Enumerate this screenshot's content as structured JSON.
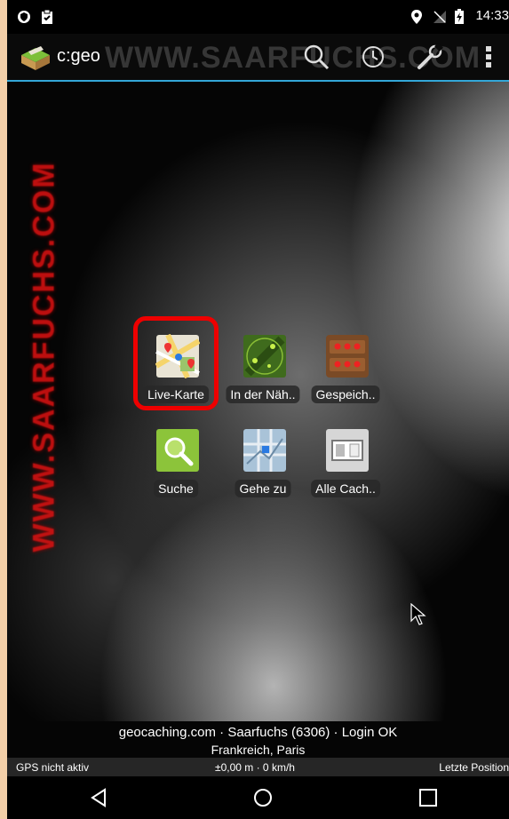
{
  "status_bar": {
    "time": "14:33",
    "icons": [
      "shield-icon",
      "clipboard-icon",
      "location-icon",
      "no-signal-icon",
      "battery-charging-icon"
    ]
  },
  "action_bar": {
    "app_title": "c:geo",
    "watermark": "WWW.SAARFUCHS.COM",
    "actions": [
      "search-icon",
      "history-icon",
      "settings-wrench-icon",
      "overflow-menu-icon"
    ]
  },
  "side_watermark": "WWW.SAARFUCHS.COM",
  "tiles": [
    {
      "label": "Live-Karte",
      "icon": "live-map-icon"
    },
    {
      "label": "In der Näh..",
      "icon": "radar-nearby-icon"
    },
    {
      "label": "Gespeich..",
      "icon": "stored-caches-icon"
    },
    {
      "label": "Suche",
      "icon": "search-magnifier-icon"
    },
    {
      "label": "Gehe zu",
      "icon": "go-to-map-icon"
    },
    {
      "label": "Alle Cach..",
      "icon": "all-caches-icon"
    }
  ],
  "info": {
    "login": "geocaching.com · Saarfuchs (6306) · Login OK",
    "location": "Frankreich, Paris"
  },
  "gps": {
    "status": "GPS nicht aktiv",
    "accuracy": "±0,00 m · 0 km/h",
    "last_position": "Letzte Position"
  },
  "nav": [
    "back-icon",
    "home-icon",
    "recents-icon"
  ],
  "colors": {
    "accent": "#33a7d8",
    "highlight": "#e00000"
  }
}
